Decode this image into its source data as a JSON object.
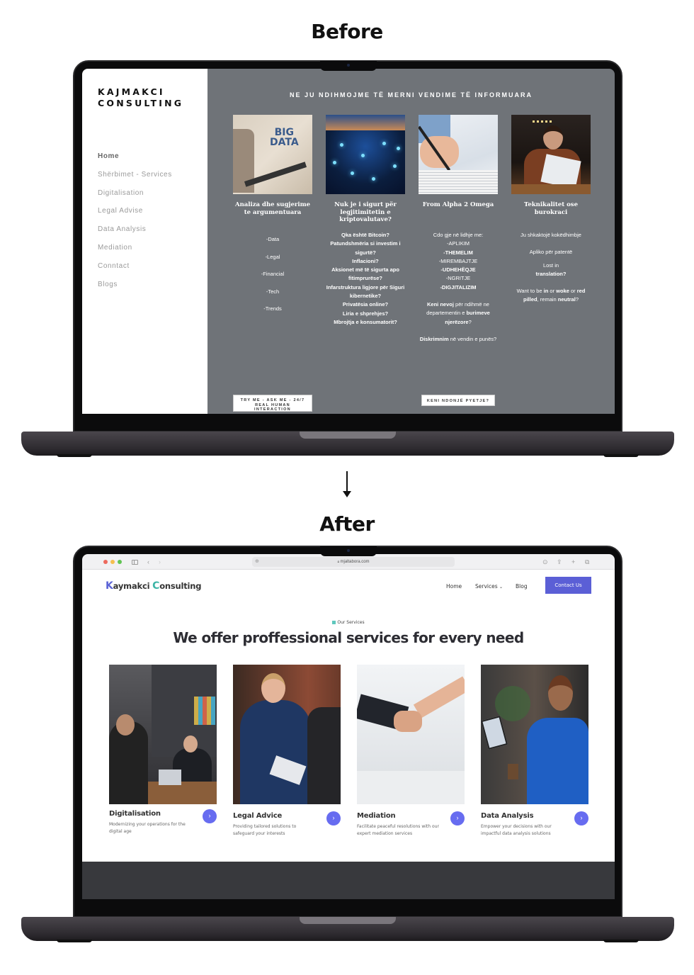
{
  "labels": {
    "before": "Before",
    "after": "After"
  },
  "before": {
    "logo_line1": "KAJMAKCI",
    "logo_line2": "CONSULTING",
    "nav": [
      "Home",
      "Shërbimet - Services",
      "Digitalisation",
      "Legal Advise",
      "Data Analysis",
      "Mediation",
      "Conntact",
      "Blogs"
    ],
    "active_nav": "Home",
    "heading": "NE JU NDIHMOJME TË MERNI VENDIME TË INFORMUARA",
    "columns": [
      {
        "image": "big-data-image",
        "title": "Analiza dhe sugjerime te argumentuara",
        "items": [
          "-Data",
          "-Legal",
          "-Financial",
          "-Tech",
          "-Trends"
        ]
      },
      {
        "image": "crypto-network-image",
        "title": "Nuk je i sigurt për legjitimitetin e kriptovalutave?",
        "items": [
          "Qka është Bitcoin?",
          "Patundshmëria si investim i sigurtë?",
          "Inflacioni?",
          "Aksionet më të sigurta apo fitimprurëse?",
          "Infarstruktura ligjore për Siguri kibernetike?",
          "Privatësia online?",
          "Liria e shprehjes?",
          "Mbrojtja e konsumatorit?"
        ]
      },
      {
        "image": "document-signing-image",
        "title": "From Alpha 2 Omega",
        "intro": "Cdo gje në lidhje me:",
        "items": [
          "-APLIKIM",
          "-THEMELIM",
          "-MIREMBAJTJE",
          "-UDHEHËQJE",
          "-NGRITJE",
          "-DIGJITALIZIM"
        ],
        "hr_text_parts": [
          "Keni nevoj",
          " për ndihmë ne departementin e ",
          "burimeve njerëzore",
          "?"
        ],
        "disc_text_parts": [
          "Diskrimnim",
          " në vendin e punës?"
        ]
      },
      {
        "image": "woman-on-phone-image",
        "title": "Teknikalitet ose burokraci",
        "lines": [
          "Ju shkaktojë kokëdhimbje",
          "Apliko për patentë",
          "Lost in",
          "translation?"
        ],
        "woke_parts": [
          "Want to be ",
          "in",
          " or ",
          "woke",
          " or ",
          "red pilled",
          ", remain ",
          "neutral",
          "?"
        ]
      }
    ],
    "btn_try": [
      "TRY ME - ASK ME - 24/7",
      "REAL HUMAN",
      "INTERACTION"
    ],
    "btn_keni": "KENI NDONJË PYETJE?"
  },
  "after": {
    "browser": {
      "url": "mjaltabora.com"
    },
    "logo": {
      "k": "K",
      "part1": "aymakci ",
      "c": "C",
      "part2": "onsulting"
    },
    "nav": {
      "home": "Home",
      "services": "Services",
      "blog": "Blog",
      "contact": "Contact Us"
    },
    "eyebrow": "Our Services",
    "heading": "We offer proffessional services for every need",
    "cards": [
      {
        "title": "Digitalisation",
        "desc": "Modernizing your operations for the digital age"
      },
      {
        "title": "Legal Advice",
        "desc": "Providing tailored solutions to safeguard your interests"
      },
      {
        "title": "Mediation",
        "desc": "Facilitate peaceful resolutions with our expert mediation services"
      },
      {
        "title": "Data Analysis",
        "desc": "Empower your decisions with our impactful data analysis solutions"
      }
    ],
    "colors": {
      "accent": "#5b5fd6",
      "teal": "#3cb5a6",
      "arrow": "#676cf0"
    }
  }
}
